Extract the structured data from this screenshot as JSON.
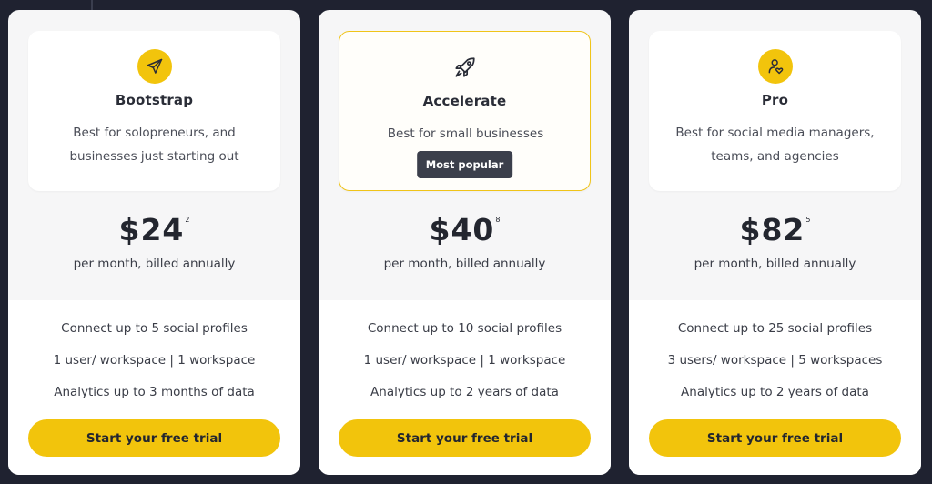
{
  "colors": {
    "background": "#1f2230",
    "accent": "#f2c40c",
    "badge": "#3b3f4b",
    "card": "#f6f6f7"
  },
  "plans": [
    {
      "icon": "paper-plane-icon",
      "name": "Bootstrap",
      "description": "Best for solopreneurs, and businesses just starting out",
      "badge": "",
      "price": "$24",
      "price_sup": "2",
      "billing": "per month, billed annually",
      "features": [
        "Connect up to 5 social profiles",
        "1 user/ workspace | 1 workspace",
        "Analytics up to 3 months of data"
      ],
      "cta": "Start your free trial"
    },
    {
      "icon": "rocket-icon",
      "name": "Accelerate",
      "description": "Best for small businesses",
      "badge": "Most popular",
      "price": "$40",
      "price_sup": "8",
      "billing": "per month, billed annually",
      "features": [
        "Connect up to 10 social profiles",
        "1 user/ workspace | 1 workspace",
        "Analytics up to 2 years of data"
      ],
      "cta": "Start your free trial"
    },
    {
      "icon": "user-heart-icon",
      "name": "Pro",
      "description": "Best for social media managers, teams, and agencies",
      "badge": "",
      "price": "$82",
      "price_sup": "5",
      "billing": "per month, billed annually",
      "features": [
        "Connect up to 25 social profiles",
        "3 users/ workspace | 5 workspaces",
        "Analytics up to 2 years of data"
      ],
      "cta": "Start your free trial"
    }
  ]
}
